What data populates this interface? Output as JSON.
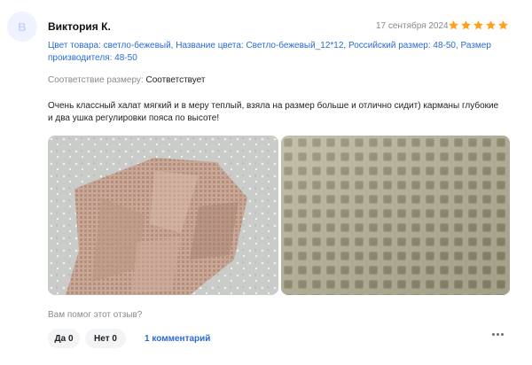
{
  "review": {
    "avatar_letter": "В",
    "author": "Виктория К.",
    "date": "17 сентября 2024",
    "rating": 5,
    "rating_max": 5,
    "star_color": "#ff9f1a",
    "properties": "Цвет товара: светло-бежевый, Название цвета: Светло-бежевый_12*12, Российский размер: 48-50, Размер производителя: 48-50",
    "fit_label": "Соответствие размеру:",
    "fit_value": "Соответствует",
    "text": "Очень классный халат мягкий и в меру теплый, взяла на размер больше и отлично сидит) карманы глубокие и два ушка регулировки пояса по высоте!",
    "photos": [
      {
        "icon": "photo-beige-waffle-robe-on-bed"
      },
      {
        "icon": "photo-waffle-fabric-closeup"
      }
    ]
  },
  "footer": {
    "helpful_question": "Вам помог этот отзыв?",
    "yes_label": "Да 0",
    "no_label": "Нет 0",
    "comments_label": "1 комментарий",
    "more_icon": "more-dots-icon"
  },
  "colors": {
    "link": "#2a6bd4",
    "muted": "#8a8a8a",
    "pill_bg": "#f3f4f6"
  }
}
